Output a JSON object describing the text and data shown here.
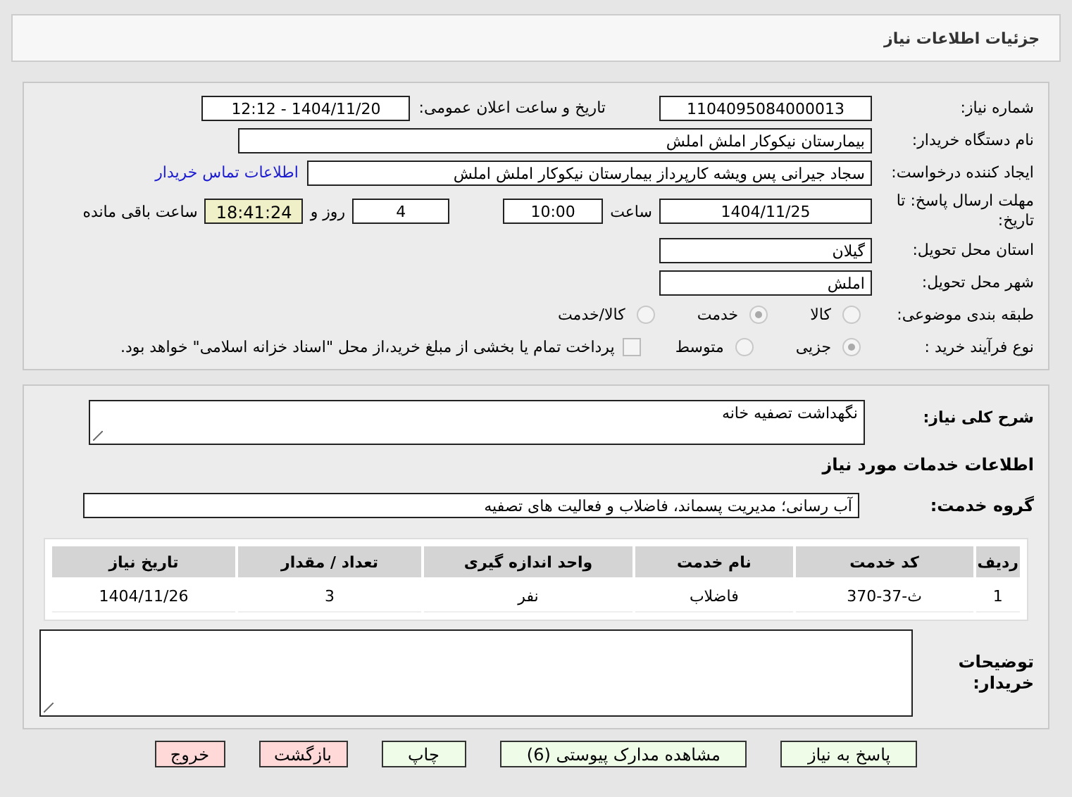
{
  "header": {
    "title": "جزئیات اطلاعات نیاز"
  },
  "details": {
    "need_number": {
      "label": "شماره نیاز:",
      "value": "1104095084000013"
    },
    "announce": {
      "label": "تاریخ و ساعت اعلان عمومی:",
      "value": "1404/11/20 - 12:12"
    },
    "buyer": {
      "label": "نام دستگاه خریدار:",
      "value": "بیمارستان نیکوکار املش املش"
    },
    "creator": {
      "label": "ایجاد کننده درخواست:",
      "value": "سجاد جیرانی پس ویشه کارپرداز بیمارستان نیکوکار املش املش",
      "link": "اطلاعات تماس خریدار"
    },
    "deadline": {
      "label": "مهلت ارسال پاسخ: تا تاریخ:",
      "date": "1404/11/25",
      "time_label": "ساعت",
      "time": "10:00",
      "days": "4",
      "days_label": "روز و",
      "remaining": "18:41:24",
      "remaining_label": "ساعت باقی مانده"
    },
    "province": {
      "label": "استان محل تحویل:",
      "value": "گیلان"
    },
    "city": {
      "label": "شهر محل تحویل:",
      "value": "املش"
    },
    "category": {
      "label": "طبقه بندی موضوعی:",
      "options": [
        {
          "label": "کالا",
          "selected": false
        },
        {
          "label": "خدمت",
          "selected": true
        },
        {
          "label": "کالا/خدمت",
          "selected": false
        }
      ]
    },
    "process": {
      "label": "نوع فرآیند خرید :",
      "options": [
        {
          "label": "جزیی",
          "selected": true
        },
        {
          "label": "متوسط",
          "selected": false
        }
      ],
      "treasury": {
        "label": "پرداخت تمام یا بخشی از مبلغ خرید،از محل \"اسناد خزانه اسلامی\" خواهد بود.",
        "checked": false
      }
    }
  },
  "services": {
    "description": {
      "label": "شرح کلی نیاز:",
      "value": "نگهداشت تصفیه خانه"
    },
    "heading": "اطلاعات خدمات مورد نیاز",
    "group": {
      "label": "گروه خدمت:",
      "value": "آب رسانی؛ مدیریت پسماند، فاضلاب و فعالیت های تصفیه"
    },
    "table": {
      "columns": [
        "ردیف",
        "کد خدمت",
        "نام خدمت",
        "واحد اندازه گیری",
        "تعداد / مقدار",
        "تاریخ نیاز"
      ],
      "rows": [
        [
          "1",
          "ث-37-370",
          "فاضلاب",
          "نفر",
          "3",
          "1404/11/26"
        ]
      ]
    },
    "notes": {
      "label": "توضیحات خریدار:"
    }
  },
  "buttons": [
    {
      "label": "پاسخ به نیاز",
      "kind": "normal"
    },
    {
      "label": "مشاهده مدارک پیوستی (6)",
      "kind": "normal"
    },
    {
      "label": "چاپ",
      "kind": "normal"
    },
    {
      "label": "بازگشت",
      "kind": "danger"
    },
    {
      "label": "خروج",
      "kind": "danger"
    }
  ]
}
